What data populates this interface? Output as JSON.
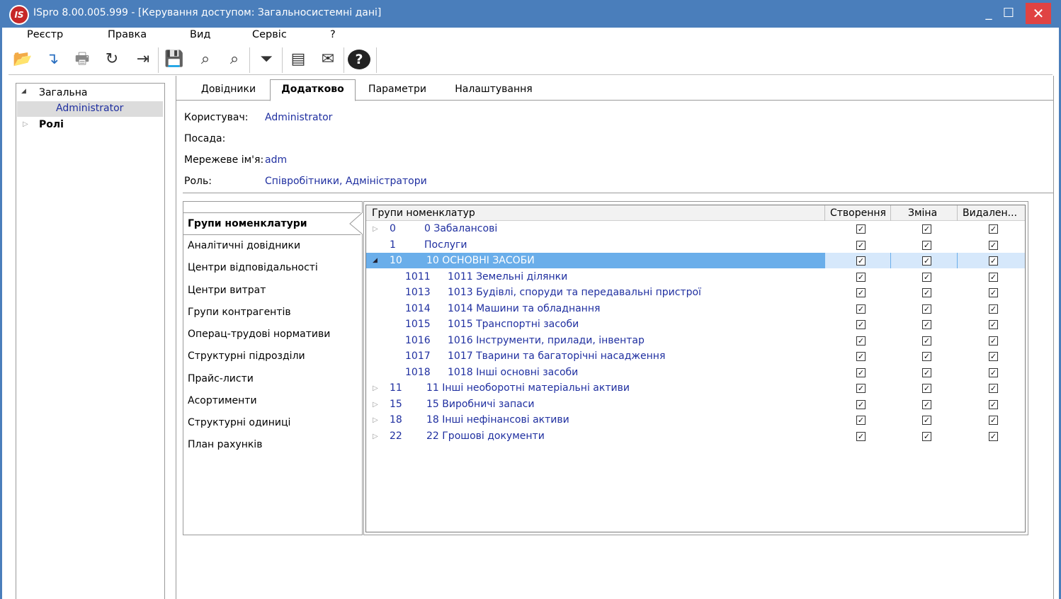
{
  "window": {
    "logo_text": "IS",
    "title": "ISpro 8.00.005.999 - [Керування доступом:  Загальносистемні дані]",
    "minimize": "_",
    "maximize": "☐",
    "close": "✕"
  },
  "menu": [
    "Реєстр",
    "Правка",
    "Вид",
    "Сервіс",
    "?"
  ],
  "toolbar": [
    {
      "icon": "open-folder-icon",
      "glyph": "📂"
    },
    {
      "icon": "import-icon",
      "glyph": "↴"
    },
    {
      "icon": "print-icon",
      "glyph": "🖶"
    },
    {
      "icon": "refresh-icon",
      "glyph": "↻"
    },
    {
      "icon": "exit-icon",
      "glyph": "⇥"
    },
    {
      "icon": "save-icon",
      "glyph": "💾"
    },
    {
      "icon": "find-icon",
      "glyph": "⌕"
    },
    {
      "icon": "find-next-icon",
      "glyph": "⌕"
    },
    {
      "icon": "filter-icon",
      "glyph": "⏷"
    },
    {
      "icon": "document-icon",
      "glyph": "▤"
    },
    {
      "icon": "mail-icon",
      "glyph": "✉"
    },
    {
      "icon": "help-icon",
      "glyph": "?"
    }
  ],
  "tree": {
    "root_expander": "◢",
    "root_label": "Загальна",
    "selected_child": "Administrator",
    "roles_expander": "▷",
    "roles_label": "Ролі"
  },
  "tabs": [
    "Довідники",
    "Додатково",
    "Параметри",
    "Налаштування"
  ],
  "active_tab": "Додатково",
  "fields": {
    "user_label": "Користувач:",
    "user_value": "Administrator",
    "position_label": "Посада:",
    "position_value": "",
    "network_label": "Мережеве ім'я:",
    "network_value": "adm",
    "role_label": "Роль:",
    "role_value": "Співробітники, Адміністратори"
  },
  "categories": [
    "Групи номенклатури",
    "Аналітичні довідники",
    "Центри відповідальності",
    "Центри витрат",
    "Групи контрагентів",
    "Операц-трудові нормативи",
    "Структурні підрозділи",
    "Прайс-листи",
    "Асортименти",
    "Структурні одиниці",
    "План рахунків"
  ],
  "grid": {
    "headers": [
      "Групи номенклатур",
      "Створення",
      "Зміна",
      "Видален..."
    ],
    "check_glyph": "✓",
    "rows": [
      {
        "expander": "▷",
        "code": "0",
        "name": "0 Забалансові",
        "create": true,
        "edit": true,
        "delete": true
      },
      {
        "expander": "",
        "code": "1",
        "name": "Послуги",
        "create": true,
        "edit": true,
        "delete": true
      },
      {
        "expander": "◢",
        "code": "10",
        "name": "10 ОСНОВНІ ЗАСОБИ",
        "create": true,
        "edit": true,
        "delete": true,
        "selected": true
      },
      {
        "expander": "",
        "code": "1011",
        "name": "1011 Земельні ділянки",
        "create": true,
        "edit": true,
        "delete": true,
        "child": true
      },
      {
        "expander": "",
        "code": "1013",
        "name": "1013 Будівлі, споруди та передавальні пристрої",
        "create": true,
        "edit": true,
        "delete": true,
        "child": true
      },
      {
        "expander": "",
        "code": "1014",
        "name": "1014 Машини та обладнання",
        "create": true,
        "edit": true,
        "delete": true,
        "child": true
      },
      {
        "expander": "",
        "code": "1015",
        "name": "1015 Транспортні засоби",
        "create": true,
        "edit": true,
        "delete": true,
        "child": true
      },
      {
        "expander": "",
        "code": "1016",
        "name": "1016 Інструменти, прилади, інвентар",
        "create": true,
        "edit": true,
        "delete": true,
        "child": true
      },
      {
        "expander": "",
        "code": "1017",
        "name": "1017 Тварини та багаторічні насадження",
        "create": true,
        "edit": true,
        "delete": true,
        "child": true
      },
      {
        "expander": "",
        "code": "1018",
        "name": "1018 Інші основні засоби",
        "create": true,
        "edit": true,
        "delete": true,
        "child": true
      },
      {
        "expander": "▷",
        "code": "11",
        "name": "11 Інші необоротні матеріальні активи",
        "create": true,
        "edit": true,
        "delete": true
      },
      {
        "expander": "▷",
        "code": "15",
        "name": "15 Виробничі запаси",
        "create": true,
        "edit": true,
        "delete": true
      },
      {
        "expander": "▷",
        "code": "18",
        "name": "18 Інші нефінансові активи",
        "create": true,
        "edit": true,
        "delete": true
      },
      {
        "expander": "▷",
        "code": "22",
        "name": "22 Грошові документи",
        "create": true,
        "edit": true,
        "delete": true
      }
    ]
  }
}
